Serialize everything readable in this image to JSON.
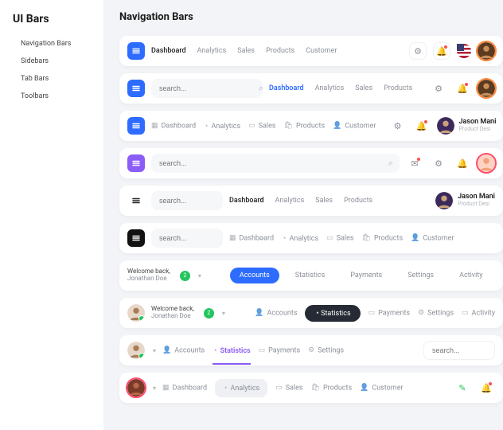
{
  "sidebar": {
    "title": "UI Bars",
    "items": [
      "Navigation Bars",
      "Sidebars",
      "Tab Bars",
      "Toolbars"
    ]
  },
  "page": {
    "title": "Navigation Bars"
  },
  "links": {
    "dashboard": "Dashboard",
    "analytics": "Analytics",
    "sales": "Sales",
    "products": "Products",
    "customer": "Customer",
    "statistics": "Statistics",
    "payments": "Payments",
    "settings": "Settings",
    "activity": "Activity",
    "accounts": "Accounts"
  },
  "search": {
    "placeholder": "search..."
  },
  "user": {
    "name": "Jason Mani",
    "role": "Product Desi",
    "welcome_t1": "Welcome back,",
    "welcome_t2": "Jonathan Doe",
    "badge": "2"
  },
  "colors": {
    "blue": "#2d6cff",
    "purple": "#8b5cf6",
    "dark": "#121212",
    "green": "#22c55e",
    "red": "#ff4d4f",
    "orange": "#ff8a3d"
  }
}
